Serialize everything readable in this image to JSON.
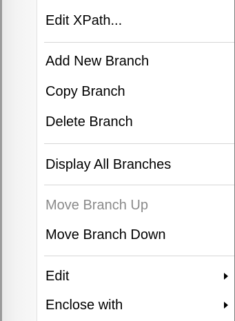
{
  "menu": {
    "items": [
      {
        "label": "Edit XPath...",
        "enabled": true
      },
      {
        "label": "Add New Branch",
        "enabled": true
      },
      {
        "label": "Copy Branch",
        "enabled": true
      },
      {
        "label": "Delete Branch",
        "enabled": true
      },
      {
        "label": "Display All Branches",
        "enabled": true
      },
      {
        "label": "Move Branch Up",
        "enabled": false
      },
      {
        "label": "Move Branch Down",
        "enabled": true
      },
      {
        "label": "Edit",
        "enabled": true,
        "submenu": true,
        "submenu_icon": "chevron-right-icon"
      },
      {
        "label": "Enclose with",
        "enabled": true,
        "submenu": true,
        "submenu_icon": "chevron-right-icon"
      }
    ],
    "colors": {
      "text": "#000000",
      "disabled_text": "#8a8a8a",
      "separator": "#d6d6d6",
      "gutter": "#f3f3f3",
      "border": "#9a9a9a"
    }
  }
}
